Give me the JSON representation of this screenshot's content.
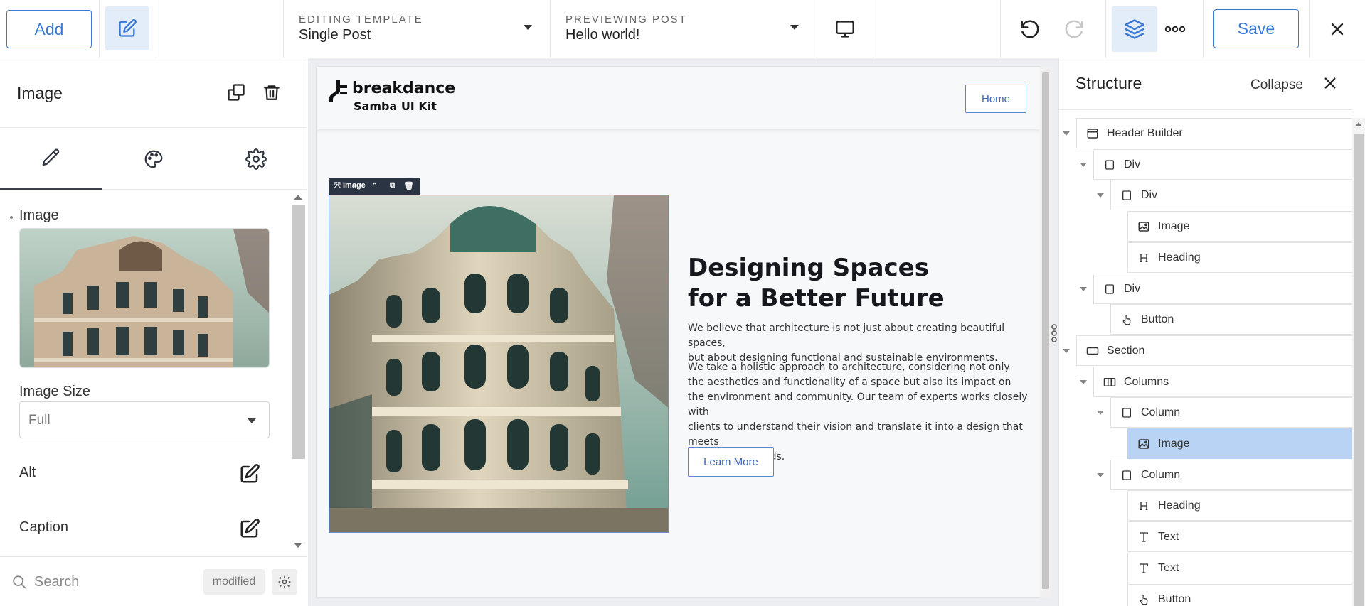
{
  "topbar": {
    "add_label": "Add",
    "editing_label": "EDITING TEMPLATE",
    "editing_value": "Single Post",
    "previewing_label": "PREVIEWING POST",
    "previewing_value": "Hello world!",
    "save_label": "Save",
    "accent_color": "#3a78d6"
  },
  "left_panel": {
    "title": "Image",
    "image_label": "Image",
    "image_size_label": "Image Size",
    "image_size_value": "Full",
    "alt_label": "Alt",
    "caption_label": "Caption",
    "search_placeholder": "Search",
    "modified_label": "modified"
  },
  "canvas": {
    "logo_name": "breakdance",
    "logo_sub": "Samba UI Kit",
    "home_label": "Home",
    "image_toolbar_label": "Image",
    "hero_heading_line1": "Designing Spaces",
    "hero_heading_line2": "for a Better Future",
    "hero_p1_line1": "We believe that architecture is not just about creating beautiful spaces,",
    "hero_p1_line2": "but about designing functional and sustainable environments.",
    "hero_p2_line1": "We take a holistic approach to architecture, considering not only",
    "hero_p2_line2": "the aesthetics and functionality of a space but also its impact on",
    "hero_p2_line3": "the environment and community. Our team of experts works closely with",
    "hero_p2_line4": "clients to understand their vision and translate it into a design that meets",
    "hero_p2_line5": "their unique needs.",
    "learn_more_label": "Learn More"
  },
  "structure": {
    "title": "Structure",
    "collapse_label": "Collapse",
    "nodes": [
      {
        "label": "Header Builder",
        "icon": "header-icon",
        "depth": 0,
        "selected": false
      },
      {
        "label": "Div",
        "icon": "div-icon",
        "depth": 1,
        "selected": false
      },
      {
        "label": "Div",
        "icon": "div-icon",
        "depth": 2,
        "selected": false
      },
      {
        "label": "Image",
        "icon": "image-icon",
        "depth": 3,
        "selected": false
      },
      {
        "label": "Heading",
        "icon": "heading-icon",
        "depth": 3,
        "selected": false
      },
      {
        "label": "Div",
        "icon": "div-icon",
        "depth": 1,
        "selected": false
      },
      {
        "label": "Button",
        "icon": "button-icon",
        "depth": 2,
        "selected": false
      },
      {
        "label": "Section",
        "icon": "section-icon",
        "depth": 0,
        "selected": false
      },
      {
        "label": "Columns",
        "icon": "columns-icon",
        "depth": 1,
        "selected": false
      },
      {
        "label": "Column",
        "icon": "div-icon",
        "depth": 2,
        "selected": false
      },
      {
        "label": "Image",
        "icon": "image-icon",
        "depth": 3,
        "selected": true
      },
      {
        "label": "Column",
        "icon": "div-icon",
        "depth": 2,
        "selected": false
      },
      {
        "label": "Heading",
        "icon": "heading-icon",
        "depth": 3,
        "selected": false
      },
      {
        "label": "Text",
        "icon": "text-icon",
        "depth": 3,
        "selected": false
      },
      {
        "label": "Text",
        "icon": "text-icon",
        "depth": 3,
        "selected": false
      },
      {
        "label": "Button",
        "icon": "button-icon",
        "depth": 3,
        "selected": false
      }
    ]
  }
}
